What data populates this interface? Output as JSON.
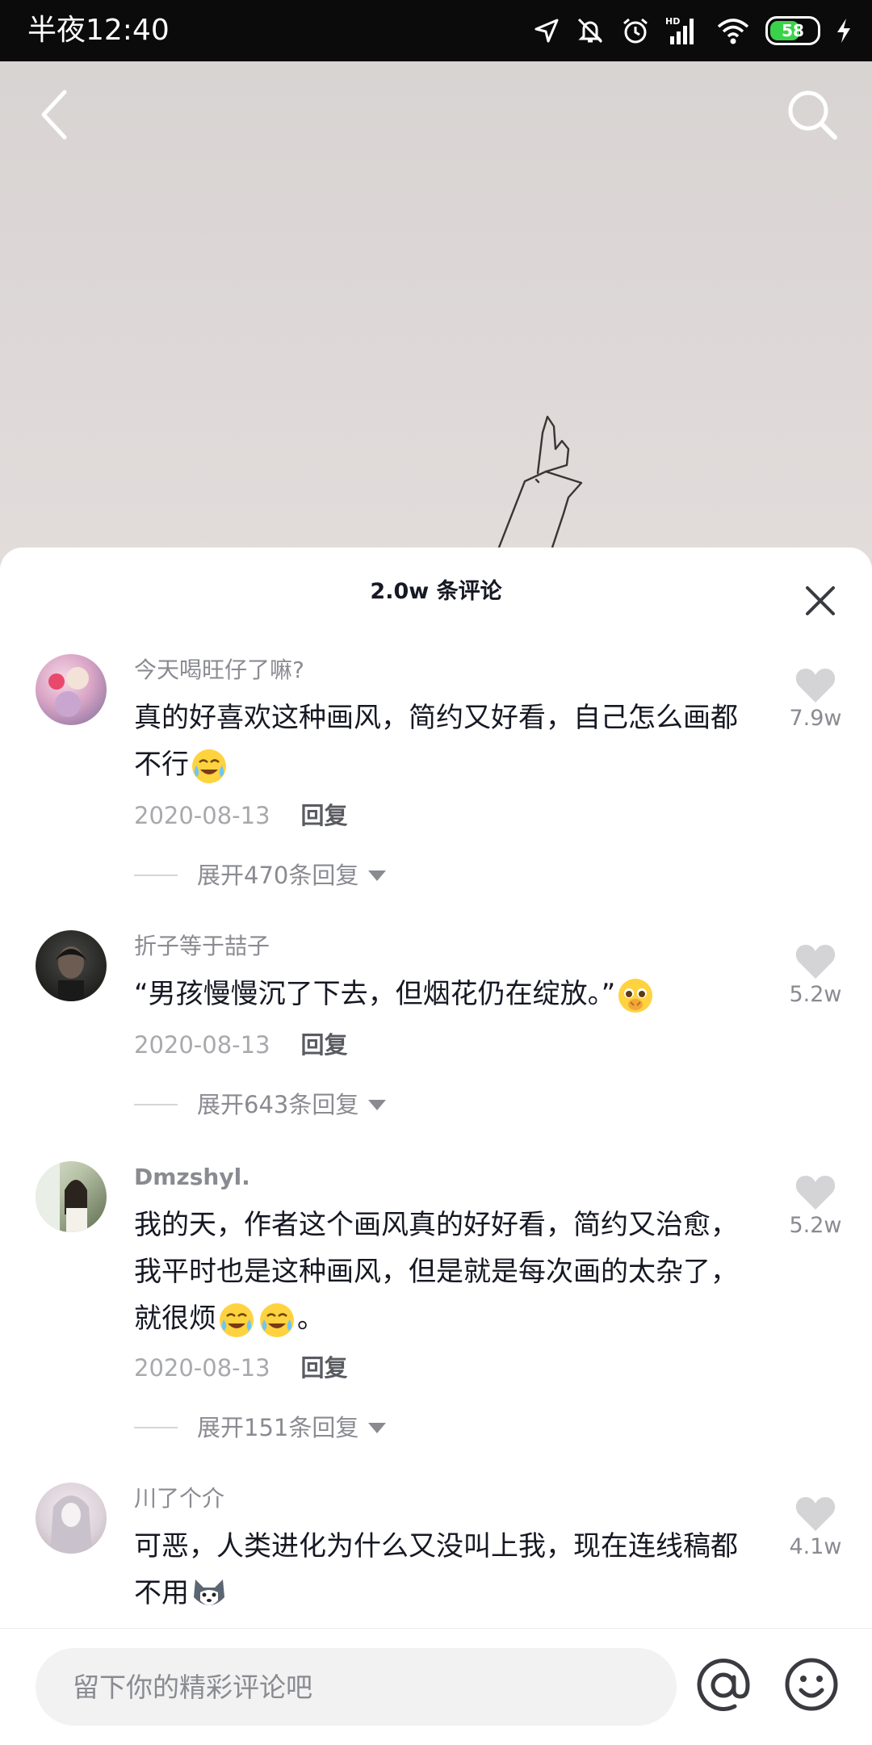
{
  "status_bar": {
    "time": "半夜12:40",
    "battery_level": "58",
    "icons": [
      "location-icon",
      "mute-icon",
      "alarm-icon",
      "hd-signal-icon",
      "wifi-icon",
      "battery-icon",
      "charging-icon"
    ]
  },
  "video": {
    "back_icon": "back-arrow-icon",
    "search_icon": "search-icon"
  },
  "comments_sheet": {
    "title": "2.0w 条评论",
    "close_icon": "close-icon",
    "comments": [
      {
        "username": "今天喝旺仔了嘛?",
        "text": "真的好喜欢这种画风，简约又好看，自己怎么画都不行",
        "date": "2020-08-13",
        "reply_label": "回复",
        "expand_label": "展开470条回复",
        "likes": "7.9w"
      },
      {
        "username": "折子等于喆子",
        "text": "“男孩慢慢沉了下去，但烟花仍在绽放。”",
        "date": "2020-08-13",
        "reply_label": "回复",
        "expand_label": "展开643条回复",
        "likes": "5.2w"
      },
      {
        "username": "Dmzshyl.",
        "text": "我的天，作者这个画风真的好好看，简约又治愈，我平时也是这种画风，但是就是每次画的太杂了，就很烦",
        "text_suffix": "。",
        "date": "2020-08-13",
        "reply_label": "回复",
        "expand_label": "展开151条回复",
        "likes": "5.2w"
      },
      {
        "username": "川了个介",
        "text": "可恶，人类进化为什么又没叫上我，现在连线稿都不用",
        "likes": "4.1w"
      }
    ]
  },
  "input_bar": {
    "placeholder": "留下你的精彩评论吧",
    "at_icon": "at-icon",
    "emoji_icon": "emoji-icon"
  }
}
